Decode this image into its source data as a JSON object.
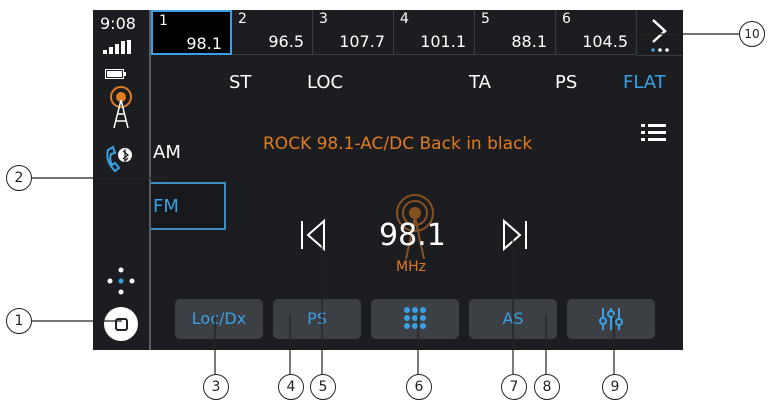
{
  "status": {
    "time": "9:08"
  },
  "presets": [
    {
      "num": "1",
      "freq": "98.1"
    },
    {
      "num": "2",
      "freq": "96.5"
    },
    {
      "num": "3",
      "freq": "107.7"
    },
    {
      "num": "4",
      "freq": "101.1"
    },
    {
      "num": "5",
      "freq": "88.1"
    },
    {
      "num": "6",
      "freq": "104.5"
    }
  ],
  "flags": {
    "st": "ST",
    "loc": "LOC",
    "ta": "TA",
    "ps": "PS",
    "flat": "FLAT"
  },
  "bands": {
    "am": "AM",
    "fm": "FM"
  },
  "station": {
    "text": "ROCK 98.1-AC/DC Back in black"
  },
  "tuner": {
    "freq": "98.1",
    "unit": "MHz"
  },
  "buttons": {
    "locdx": "Loc/Dx",
    "ps": "PS",
    "as": "AS"
  },
  "callouts": {
    "c1": "1",
    "c2": "2",
    "c3": "3",
    "c4": "4",
    "c5": "5",
    "c6": "6",
    "c7": "7",
    "c8": "8",
    "c9": "9",
    "c10": "10"
  },
  "colors": {
    "accent": "#3aa0e6",
    "highlight": "#e07b22",
    "background": "#1c1d20"
  }
}
